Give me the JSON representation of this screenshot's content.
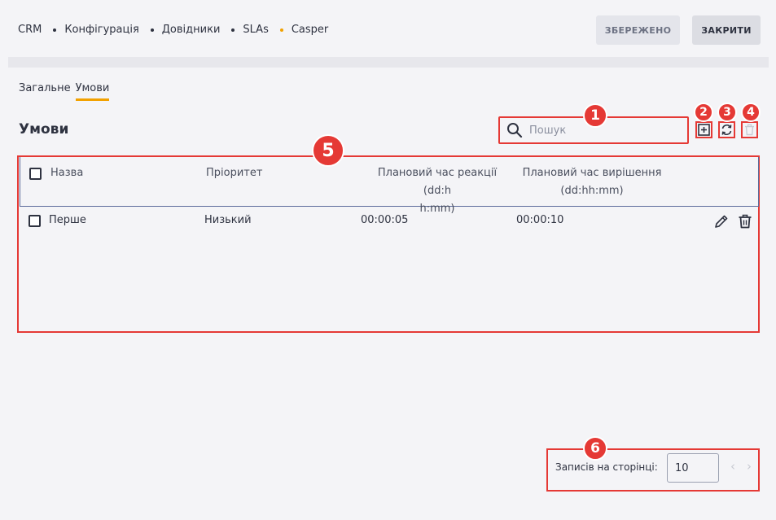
{
  "breadcrumb": [
    "CRM",
    "Конфігурація",
    "Довідники",
    "SLAs",
    "Casper"
  ],
  "buttons": {
    "saved": "ЗБЕРЕЖЕНО",
    "close": "ЗАКРИТИ"
  },
  "tabs": [
    {
      "label": "Загальне",
      "active": false
    },
    {
      "label": "Умови",
      "active": true
    }
  ],
  "section_title": "Умови",
  "search": {
    "placeholder": "Пошук"
  },
  "table": {
    "headers": {
      "name": "Назва",
      "priority": "Пріоритет",
      "reaction_line1": "Плановий час реакції (dd:h",
      "reaction_line2": "h:mm)",
      "resolve_line1": "Плановий час вирішення",
      "resolve_line2": "(dd:hh:mm)"
    },
    "rows": [
      {
        "name": "Перше",
        "priority": "Низький",
        "reaction": "00:00:05",
        "resolve": "00:00:10"
      }
    ]
  },
  "pagination": {
    "label": "Записів на сторінці:",
    "page_size": "10",
    "prev": "‹",
    "next": "›"
  },
  "badges": [
    "1",
    "2",
    "3",
    "4",
    "5",
    "6"
  ],
  "colors": {
    "accent": "#f2a100",
    "highlight": "#e53935"
  }
}
